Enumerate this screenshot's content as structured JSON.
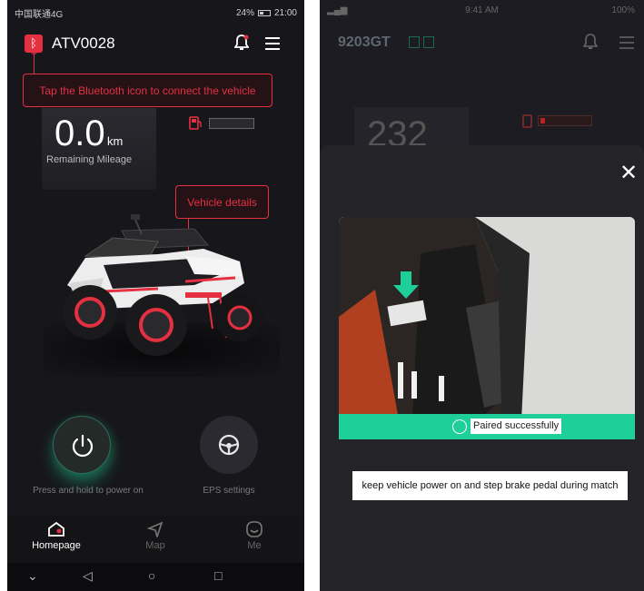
{
  "left_screen": {
    "status_bar": {
      "carrier": "中国联通4G",
      "battery": "24%",
      "time": "21:00"
    },
    "header": {
      "vehicle_name": "ATV0028"
    },
    "bluetooth_tip": "Tap the Bluetooth icon to connect the vehicle",
    "mileage": {
      "value": "0.0",
      "unit": "km",
      "label": "Remaining Mileage"
    },
    "details_tip": "Vehicle details",
    "power": {
      "label": "Press and hold to power on"
    },
    "eps": {
      "label": "EPS settings"
    },
    "nav": [
      {
        "label": "Homepage",
        "icon": "home-icon",
        "active": true
      },
      {
        "label": "Map",
        "icon": "navigation-arrow-icon",
        "active": false
      },
      {
        "label": "Me",
        "icon": "user-face-icon",
        "active": false
      }
    ],
    "colors": {
      "accent": "#e53041",
      "power_glow": "#1ee6a0",
      "background": "#17171b"
    }
  },
  "right_screen": {
    "status_bar": {
      "time": "9:41 AM",
      "battery": "100%"
    },
    "header": {
      "vehicle_name": "9203GT"
    },
    "mileage_value": "232",
    "paired_text": "Paired successfully",
    "hint": "keep vehicle power on and step brake pedal during match",
    "colors": {
      "success": "#1fcf9a"
    }
  }
}
